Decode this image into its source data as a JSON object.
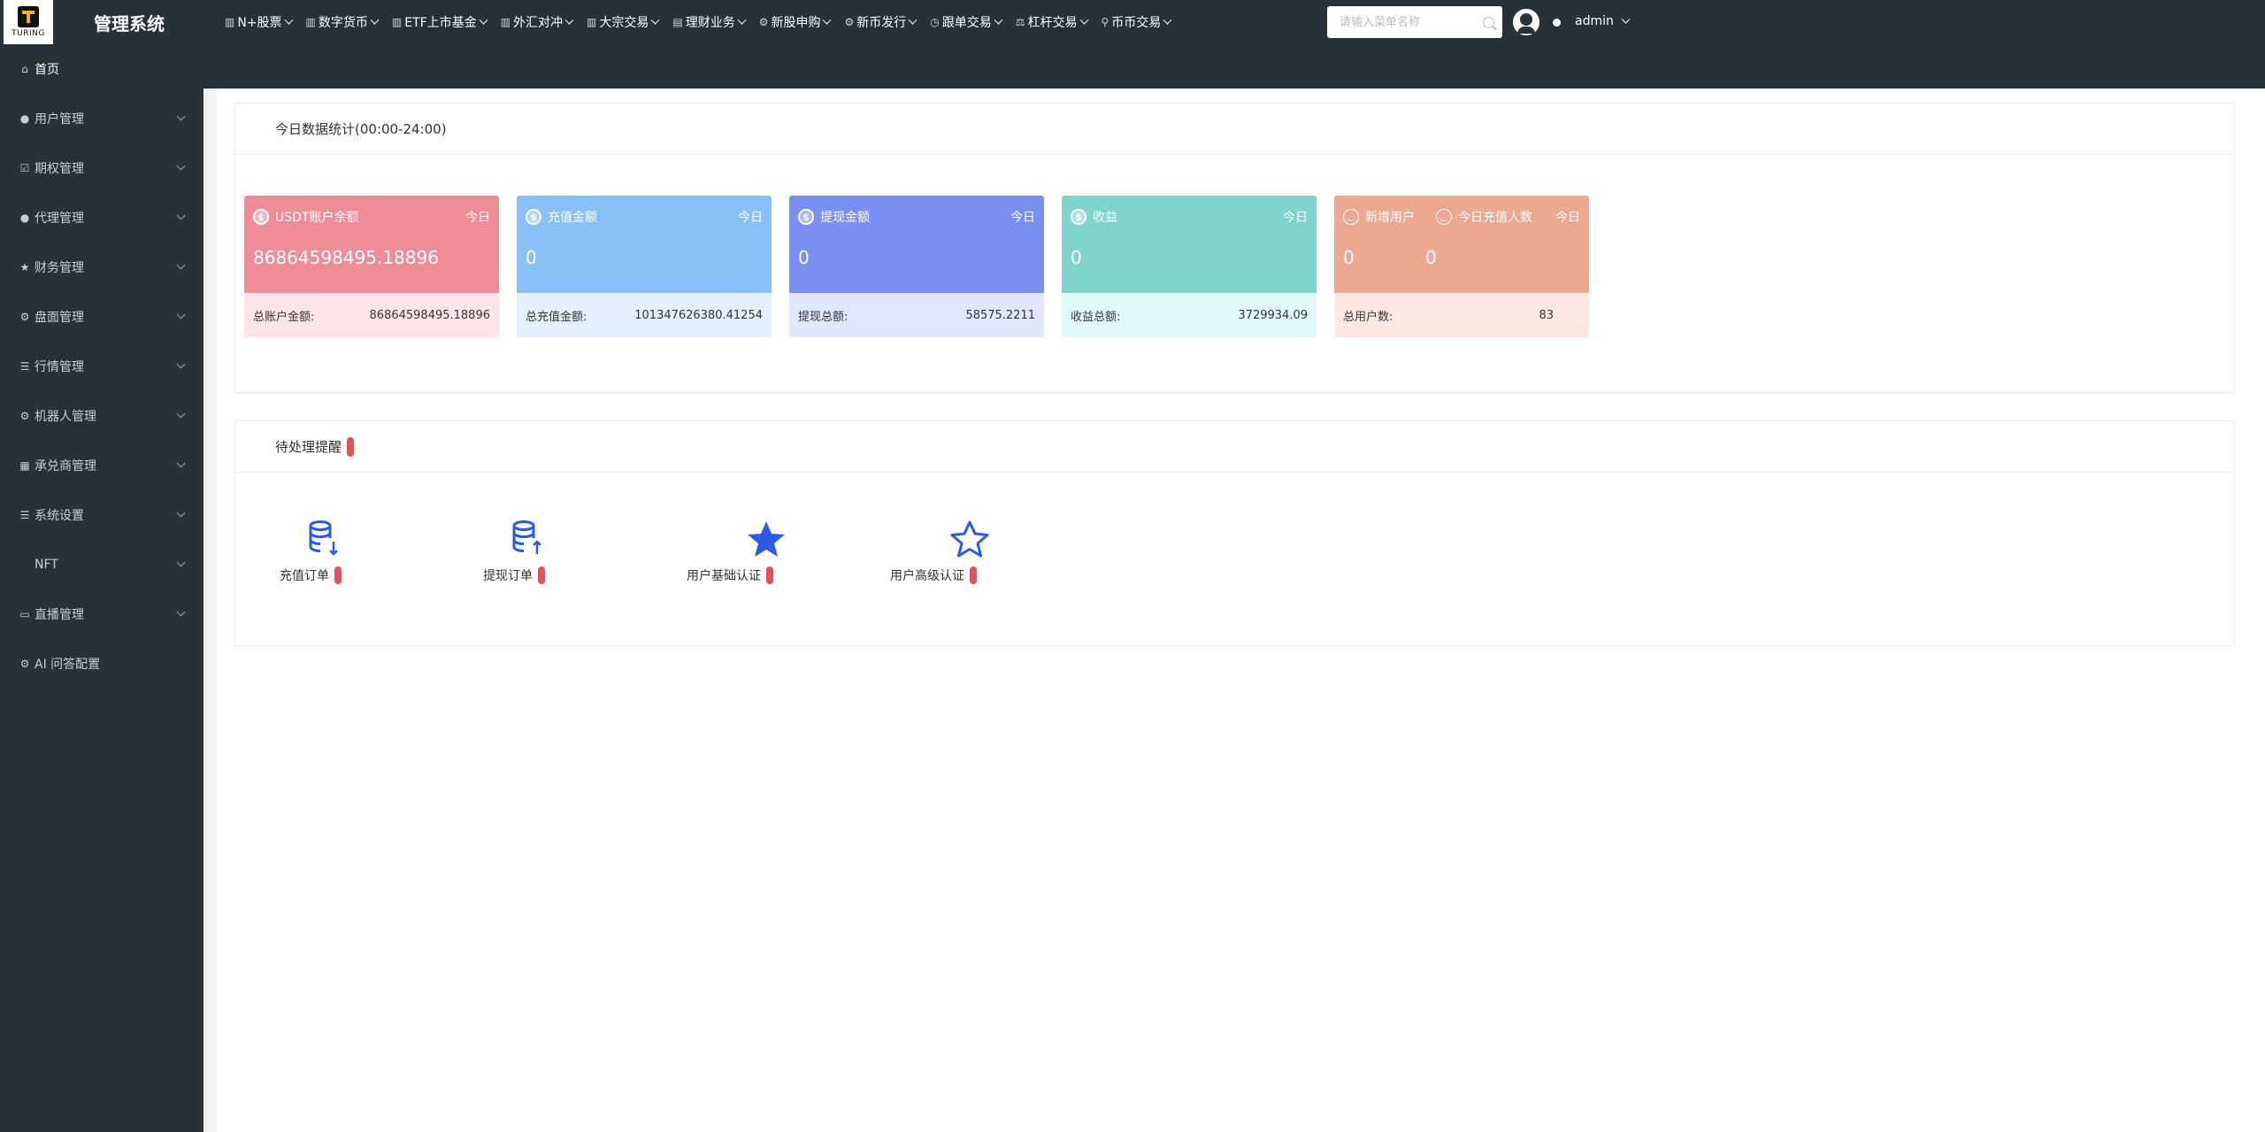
{
  "brand": {
    "logo_text": "TURING",
    "title": "管理系统"
  },
  "topnav": [
    {
      "icon": "bar-chart-icon",
      "label": "N+股票"
    },
    {
      "icon": "bar-chart-icon",
      "label": "数字货币"
    },
    {
      "icon": "bar-chart-icon",
      "label": "ETF上市基金"
    },
    {
      "icon": "bar-chart-icon",
      "label": "外汇对冲"
    },
    {
      "icon": "bar-chart-icon",
      "label": "大宗交易"
    },
    {
      "icon": "calendar-icon",
      "label": "理财业务"
    },
    {
      "icon": "gear-icon",
      "label": "新股申购"
    },
    {
      "icon": "gear-icon",
      "label": "新币发行"
    },
    {
      "icon": "clock-icon",
      "label": "跟单交易"
    },
    {
      "icon": "scale-icon",
      "label": "杠杆交易"
    },
    {
      "icon": "pin-icon",
      "label": "币币交易"
    }
  ],
  "search": {
    "placeholder": "请输入菜单名称",
    "value": ""
  },
  "user": {
    "name": "admin"
  },
  "sidebar": [
    {
      "icon": "home-icon",
      "label": "首页",
      "expandable": false
    },
    {
      "icon": "user-icon",
      "label": "用户管理",
      "expandable": true
    },
    {
      "icon": "checkbox-icon",
      "label": "期权管理",
      "expandable": true
    },
    {
      "icon": "user-icon",
      "label": "代理管理",
      "expandable": true
    },
    {
      "icon": "star-icon",
      "label": "财务管理",
      "expandable": true
    },
    {
      "icon": "gear-icon",
      "label": "盘面管理",
      "expandable": true
    },
    {
      "icon": "list-icon",
      "label": "行情管理",
      "expandable": true
    },
    {
      "icon": "gear-icon",
      "label": "机器人管理",
      "expandable": true
    },
    {
      "icon": "table-icon",
      "label": "承兑商管理",
      "expandable": true
    },
    {
      "icon": "list-icon",
      "label": "系统设置",
      "expandable": true
    },
    {
      "icon": "",
      "label": "NFT",
      "expandable": true
    },
    {
      "icon": "video-icon",
      "label": "直播管理",
      "expandable": true
    },
    {
      "icon": "gear-icon",
      "label": "AI 问答配置",
      "expandable": false
    }
  ],
  "stats": {
    "title": "今日数据统计(00:00-24:00)",
    "cards": [
      {
        "title": "USDT账户余额",
        "tag": "今日",
        "value": "86864598495.18896",
        "footer_label": "总账户金额:",
        "footer_value": "86864598495.18896"
      },
      {
        "title": "充值金额",
        "tag": "今日",
        "value": "0",
        "footer_label": "总充值金额:",
        "footer_value": "101347626380.41254"
      },
      {
        "title": "提现金额",
        "tag": "今日",
        "value": "0",
        "footer_label": "提现总额:",
        "footer_value": "58575.2211"
      },
      {
        "title": "收益",
        "tag": "今日",
        "value": "0",
        "footer_label": "收益总额:",
        "footer_value": "3729934.09"
      },
      {
        "title": "新增用户",
        "title2": "今日充值人数",
        "tag": "今日",
        "value": "0",
        "value2": "0",
        "footer_label": "总用户数:",
        "footer_value": "83"
      }
    ]
  },
  "todo": {
    "title": "待处理提醒",
    "items": [
      {
        "icon": "database-download-icon",
        "label": "充值订单"
      },
      {
        "icon": "database-upload-icon",
        "label": "提现订单"
      },
      {
        "icon": "star-filled-icon",
        "label": "用户基础认证"
      },
      {
        "icon": "star-outline-icon",
        "label": "用户高级认证"
      }
    ]
  },
  "colors": {
    "topbar": "#263238",
    "accent_blue": "#2b5be6",
    "badge_red": "#e6505a"
  }
}
